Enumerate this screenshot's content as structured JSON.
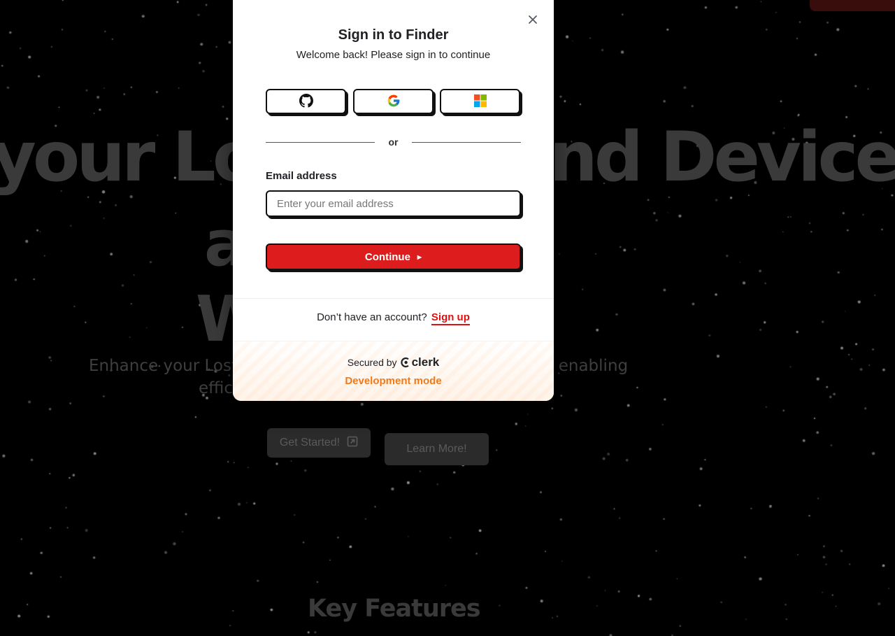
{
  "background": {
    "hero_line1": "your Lost & Found Device",
    "hero_line2": "a",
    "hero_line3": "W",
    "subtitle_line1": "Enhance your Lost & Found experience with our platform, enabling",
    "subtitle_line2": "effic n.",
    "get_started_label": "Get Started!",
    "learn_more_label": "Learn More!",
    "key_features_heading": "Key Features"
  },
  "modal": {
    "title": "Sign in to Finder",
    "subtitle": "Welcome back! Please sign in to continue",
    "social_providers": [
      {
        "name": "GitHub",
        "icon": "github-icon"
      },
      {
        "name": "Google",
        "icon": "google-icon"
      },
      {
        "name": "Microsoft",
        "icon": "microsoft-icon"
      }
    ],
    "divider_text": "or",
    "email_label": "Email address",
    "email_placeholder": "Enter your email address",
    "email_value": "",
    "continue_label": "Continue",
    "signup_prompt": "Don’t have an account?",
    "signup_link": "Sign up",
    "secured_by": "Secured by",
    "brand_name": "clerk",
    "dev_mode": "Development mode"
  },
  "colors": {
    "accent_red": "#dd1d1d",
    "dev_orange": "#f07a1a",
    "text_dark": "#212126",
    "backdrop": "#000000"
  }
}
